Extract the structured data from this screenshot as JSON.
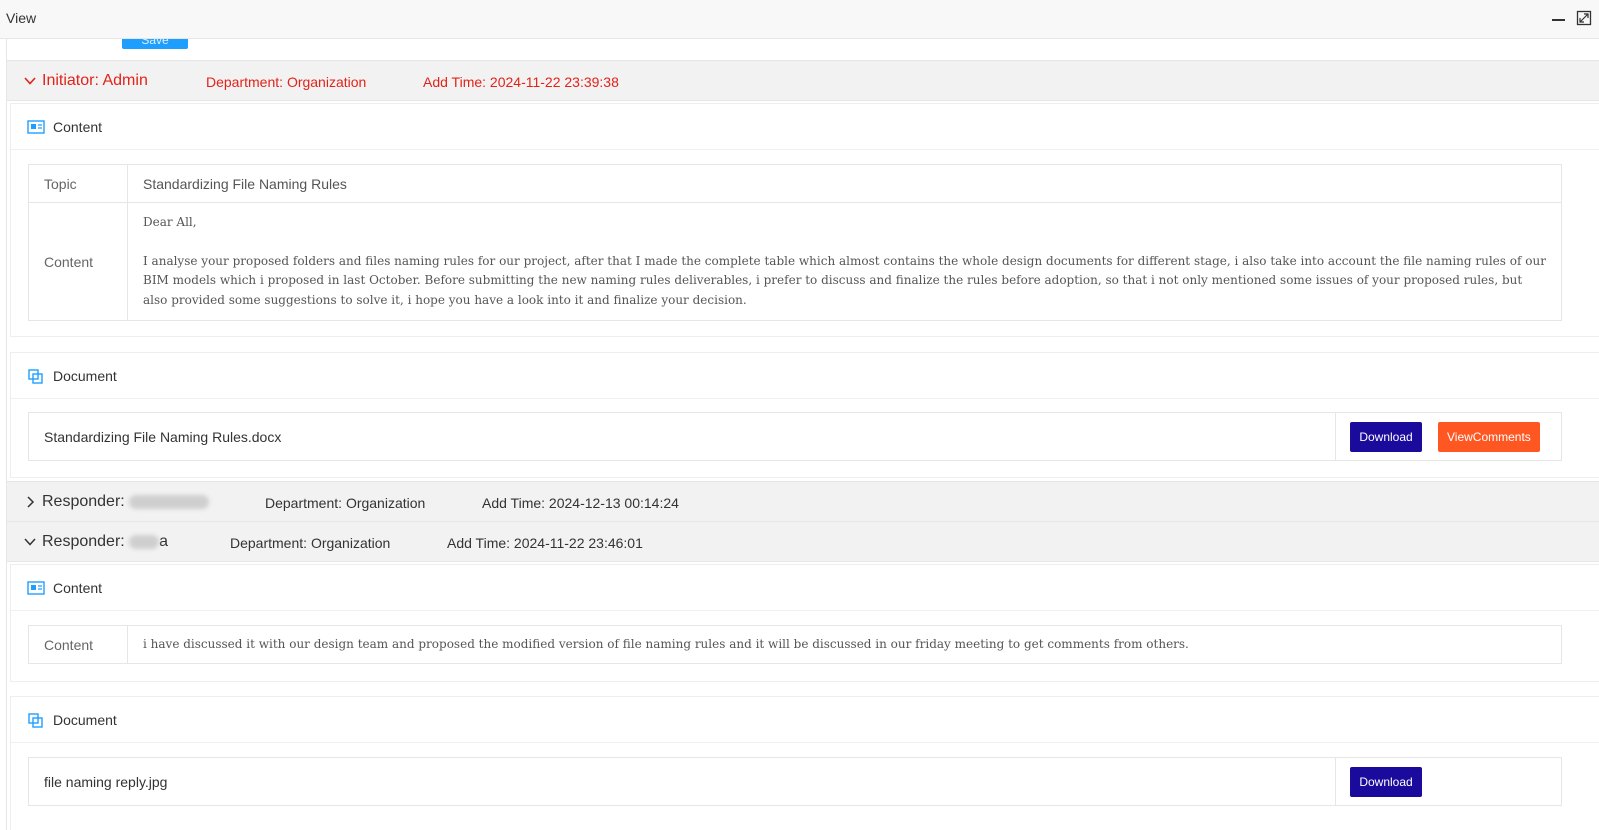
{
  "window": {
    "title": "View"
  },
  "save_stub_label": "Save",
  "initiator": {
    "role_label": "Initiator:",
    "name": "Admin",
    "department_label": "Department:",
    "department": "Organization",
    "add_time_label": "Add Time:",
    "add_time": "2024-11-22 23:39:38",
    "content_section_label": "Content",
    "topic_key": "Topic",
    "topic_value": "Standardizing File Naming Rules",
    "content_key": "Content",
    "content_greeting": "Dear All,",
    "content_body": "I analyse your proposed folders and files naming rules for our project, after that I made the complete table which almost contains the whole design documents for different stage,  i also take into account the file naming rules of our BIM models which i proposed in last October. Before submitting the new naming rules deliverables, i prefer to discuss and finalize the rules before adoption, so that i not only mentioned some issues of your proposed rules, but also provided some suggestions to solve it, i hope you have a look into it and finalize your decision.",
    "document_section_label": "Document",
    "document_file": "Standardizing File Naming Rules.docx",
    "download_label": "Download",
    "view_comments_label": "ViewComments"
  },
  "responder1": {
    "role_label": "Responder:",
    "department_label": "Department:",
    "department": "Organization",
    "add_time_label": "Add Time:",
    "add_time": "2024-12-13 00:14:24"
  },
  "responder2": {
    "role_label": "Responder:",
    "name_visible_suffix": "a",
    "department_label": "Department:",
    "department": "Organization",
    "add_time_label": "Add Time:",
    "add_time": "2024-11-22 23:46:01",
    "content_section_label": "Content",
    "content_key": "Content",
    "content_value": "i have discussed it with our design team and proposed the modified version of file naming rules and it will be discussed in our friday meeting to get comments from others.",
    "document_section_label": "Document",
    "document_file": "file naming reply.jpg",
    "download_label": "Download"
  },
  "colors": {
    "initiator_red": "#e2231a",
    "download_blue": "#1a0b9c",
    "view_comments_orange": "#ff5722",
    "header_gray": "#f2f2f2",
    "icon_blue": "#1e9fff"
  },
  "icons": {
    "minimize": "minimize-icon",
    "maximize": "maximize-icon",
    "expanded": "chevron-down-icon",
    "collapsed": "chevron-right-icon",
    "content": "content-card-icon",
    "document": "document-copy-icon"
  }
}
